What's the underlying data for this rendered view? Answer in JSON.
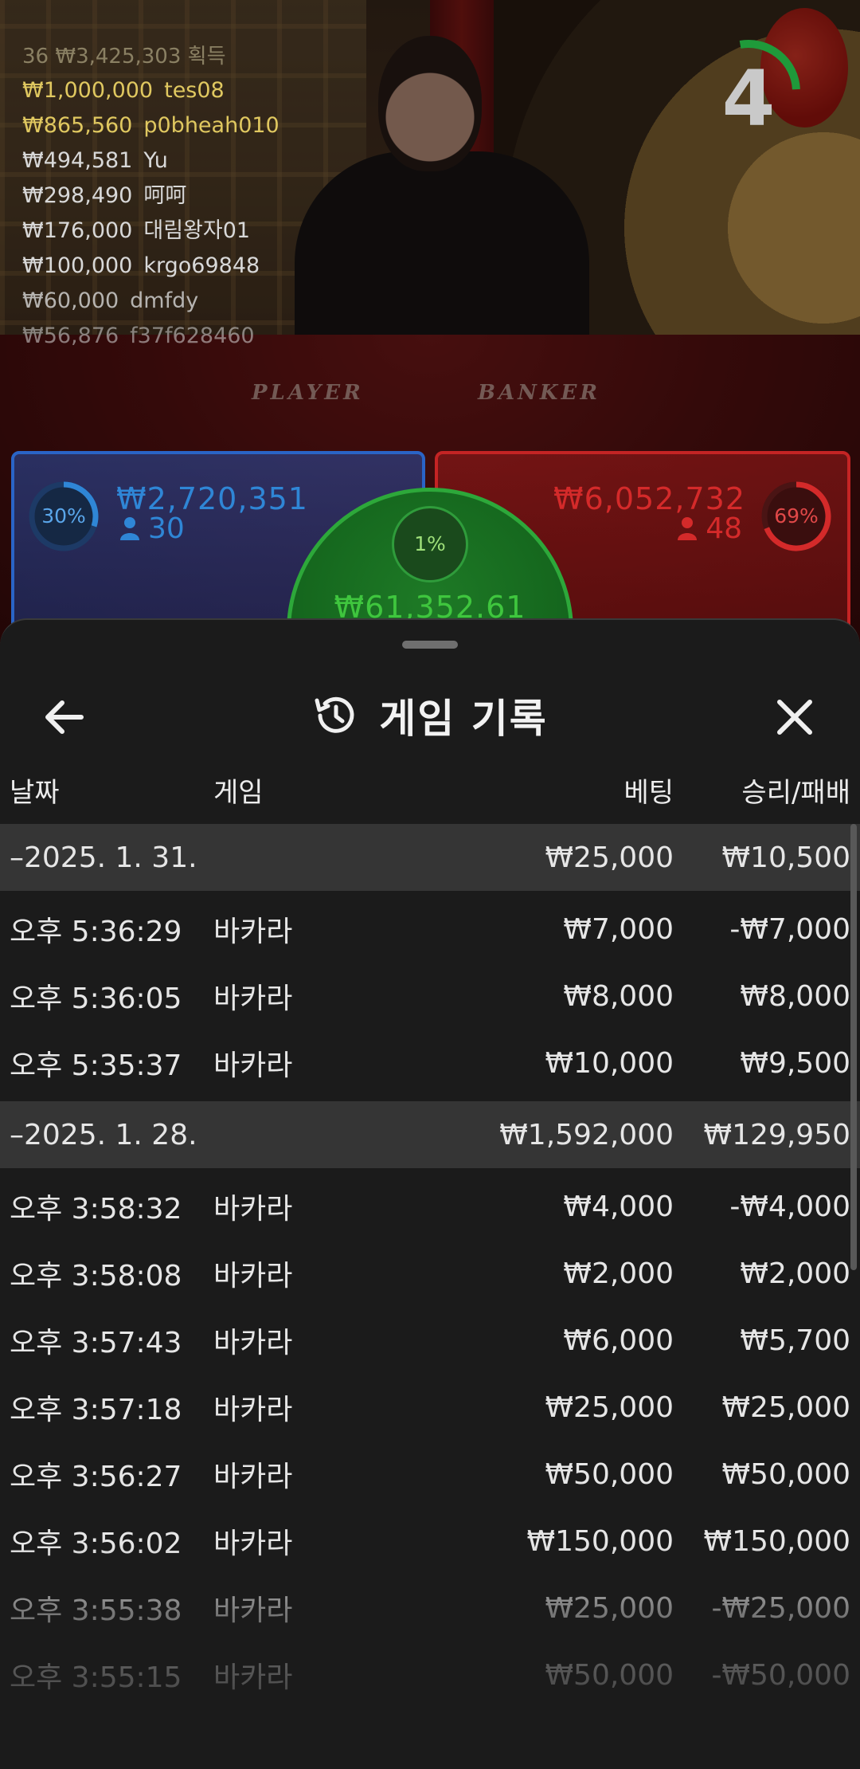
{
  "ticker": {
    "header": {
      "count": "36",
      "total": "₩3,425,303",
      "label": "획득"
    },
    "entries": [
      {
        "amount": "₩1,000,000",
        "user": "tes08"
      },
      {
        "amount": "₩865,560",
        "user": "p0bheah010"
      },
      {
        "amount": "₩494,581",
        "user": "Yu"
      },
      {
        "amount": "₩298,490",
        "user": "呵呵"
      },
      {
        "amount": "₩176,000",
        "user": "대림왕자01"
      },
      {
        "amount": "₩100,000",
        "user": "krgo69848"
      },
      {
        "amount": "₩60,000",
        "user": "dmfdy"
      },
      {
        "amount": "₩56,876",
        "user": "f37f628460"
      }
    ]
  },
  "table": {
    "player_label": "PLAYER",
    "banker_label": "BANKER"
  },
  "countdown": {
    "seconds": "4",
    "fraction_remaining": 0.27
  },
  "bets": {
    "player": {
      "percent": "30%",
      "percent_value": 0.3,
      "amount": "₩2,720,351",
      "count": "30",
      "color": "#2f86d6"
    },
    "banker": {
      "percent": "69%",
      "percent_value": 0.69,
      "amount": "₩6,052,732",
      "count": "48",
      "color": "#d42a2a"
    },
    "tie": {
      "percent": "1%",
      "amount": "₩61,352.61",
      "color": "#3fc63e"
    }
  },
  "sheet": {
    "title": "게임 기록",
    "columns": {
      "date": "날짜",
      "game": "게임",
      "bet": "베팅",
      "result": "승리/패배"
    },
    "groups": [
      {
        "date": "–2025. 1. 31.",
        "bet": "₩25,000",
        "result": "₩10,500",
        "rows": [
          {
            "time": "오후 5:36:29",
            "game": "바카라",
            "bet": "₩7,000",
            "result": "-₩7,000"
          },
          {
            "time": "오후 5:36:05",
            "game": "바카라",
            "bet": "₩8,000",
            "result": "₩8,000"
          },
          {
            "time": "오후 5:35:37",
            "game": "바카라",
            "bet": "₩10,000",
            "result": "₩9,500"
          }
        ]
      },
      {
        "date": "–2025. 1. 28.",
        "bet": "₩1,592,000",
        "result": "₩129,950",
        "rows": [
          {
            "time": "오후 3:58:32",
            "game": "바카라",
            "bet": "₩4,000",
            "result": "-₩4,000"
          },
          {
            "time": "오후 3:58:08",
            "game": "바카라",
            "bet": "₩2,000",
            "result": "₩2,000"
          },
          {
            "time": "오후 3:57:43",
            "game": "바카라",
            "bet": "₩6,000",
            "result": "₩5,700"
          },
          {
            "time": "오후 3:57:18",
            "game": "바카라",
            "bet": "₩25,000",
            "result": "₩25,000"
          },
          {
            "time": "오후 3:56:27",
            "game": "바카라",
            "bet": "₩50,000",
            "result": "₩50,000"
          },
          {
            "time": "오후 3:56:02",
            "game": "바카라",
            "bet": "₩150,000",
            "result": "₩150,000"
          },
          {
            "time": "오후 3:55:38",
            "game": "바카라",
            "bet": "₩25,000",
            "result": "-₩25,000"
          },
          {
            "time": "오후 3:55:15",
            "game": "바카라",
            "bet": "₩50,000",
            "result": "-₩50,000"
          }
        ]
      }
    ]
  },
  "colors": {
    "ticker_gold": "#e0c860",
    "ticker_light": "#d8d8d8",
    "sheet_bg": "#1b1b1b",
    "group_row_bg": "#353535"
  },
  "icons": {
    "back": "arrow-left-icon",
    "history": "history-icon",
    "close": "close-icon",
    "person": "person-icon"
  }
}
